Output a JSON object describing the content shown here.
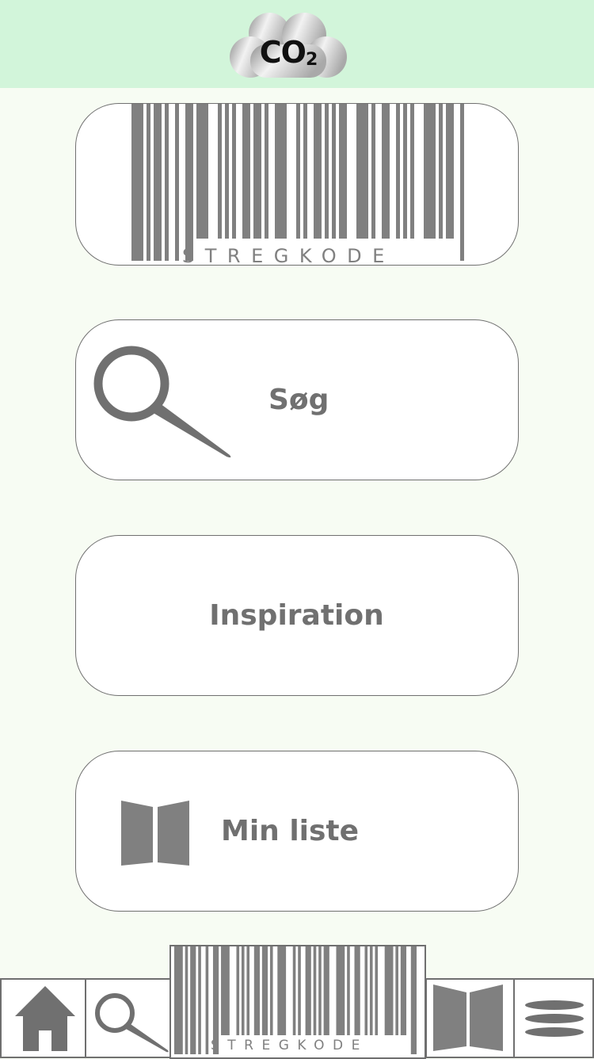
{
  "header": {
    "logo_text": "CO",
    "logo_subscript": "2"
  },
  "main": {
    "barcode_button": {
      "label": "STREGKODE",
      "icon": "barcode-icon"
    },
    "search_button": {
      "label": "Søg",
      "icon": "magnifier-icon"
    },
    "inspiration_button": {
      "label": "Inspiration"
    },
    "list_button": {
      "label": "Min liste",
      "icon": "open-book-icon"
    }
  },
  "tabbar": {
    "tabs": [
      {
        "id": "home",
        "icon": "home-icon"
      },
      {
        "id": "search",
        "icon": "magnifier-icon"
      },
      {
        "id": "scan",
        "icon": "barcode-icon",
        "label": "STREGKODE"
      },
      {
        "id": "list",
        "icon": "open-book-icon"
      },
      {
        "id": "menu",
        "icon": "menu-icon"
      }
    ]
  },
  "colors": {
    "header_bg": "#d2f5da",
    "page_bg": "#f7fcf3",
    "icon_gray": "#808080",
    "text_gray": "#707070",
    "border_gray": "#707070"
  }
}
